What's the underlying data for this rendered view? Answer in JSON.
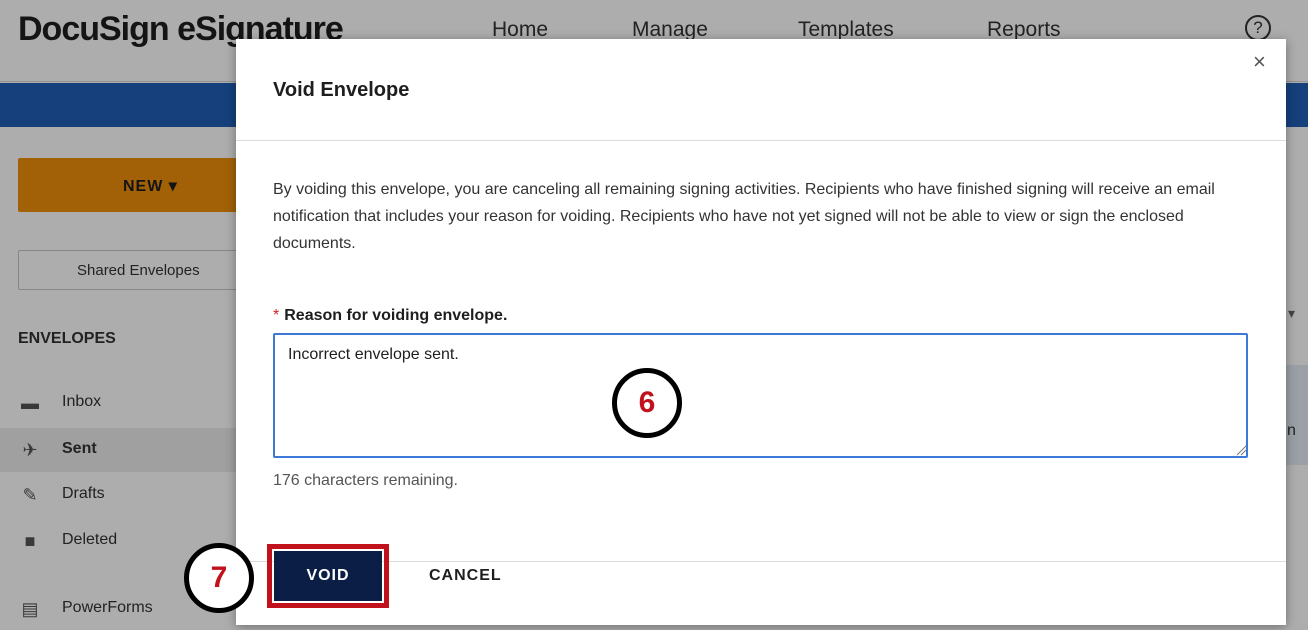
{
  "app": {
    "logo": "DocuSign eSignature",
    "nav": [
      "Home",
      "Manage",
      "Templates",
      "Reports"
    ],
    "help_icon": "help-icon",
    "new_button": "NEW ▾",
    "shared_envelopes": "Shared Envelopes",
    "envelopes_heading": "ENVELOPES",
    "sidebar": [
      {
        "label": "Inbox",
        "icon": "inbox-icon",
        "glyph": "▬"
      },
      {
        "label": "Sent",
        "icon": "send-icon",
        "glyph": "✈"
      },
      {
        "label": "Drafts",
        "icon": "draft-icon",
        "glyph": "✎"
      },
      {
        "label": "Deleted",
        "icon": "trash-icon",
        "glyph": "■"
      },
      {
        "label": "PowerForms",
        "icon": "powerforms-icon",
        "glyph": "▤"
      }
    ],
    "right_fragment": "n"
  },
  "modal": {
    "title": "Void Envelope",
    "close_glyph": "×",
    "description": "By voiding this envelope, you are canceling all remaining signing activities. Recipients who have finished signing will receive an email notification that includes your reason for voiding. Recipients who have not yet signed will not be able to view or sign the enclosed documents.",
    "required_mark": "*",
    "field_label": "Reason for voiding envelope.",
    "reason_value": "Incorrect envelope sent.",
    "chars_remaining": "176 characters remaining.",
    "void_button": "VOID",
    "cancel_button": "CANCEL"
  },
  "callouts": {
    "reason_step": "6",
    "void_step": "7"
  },
  "colors": {
    "brand_blue": "#1f5fb5",
    "new_button": "#f0900b",
    "void_button": "#0b1e45",
    "highlight_red": "#c1121c",
    "input_focus": "#3c78d8"
  }
}
